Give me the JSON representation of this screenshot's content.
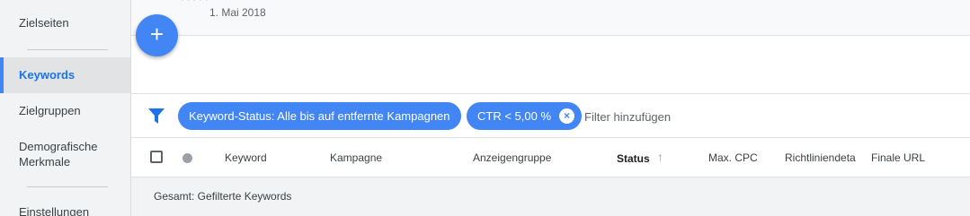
{
  "sidebar": {
    "items": [
      {
        "label": "Zielseiten"
      },
      {
        "label": "Keywords"
      },
      {
        "label": "Zielgruppen"
      },
      {
        "label": "Demografische Merkmale"
      },
      {
        "label": "Einstellungen"
      }
    ]
  },
  "top": {
    "date": "1. Mai 2018"
  },
  "fab": {
    "icon": "plus-icon",
    "symbol": "+"
  },
  "filters": {
    "chips": [
      {
        "label": "Keyword-Status: Alle bis auf entfernte Kampagnen"
      },
      {
        "label": "CTR < 5,00 %",
        "remove_symbol": "×"
      }
    ],
    "add_placeholder": "Filter hinzufügen"
  },
  "table": {
    "columns": [
      "Keyword",
      "Kampagne",
      "Anzeigengruppe",
      "Status",
      "Max. CPC",
      "Richtliniendeta",
      "Finale URL"
    ],
    "sort_symbol": "↑",
    "total_label": "Gesamt: Gefilterte Keywords"
  },
  "colors": {
    "accent": "#4285f4",
    "active_nav": "#1a73e8"
  }
}
